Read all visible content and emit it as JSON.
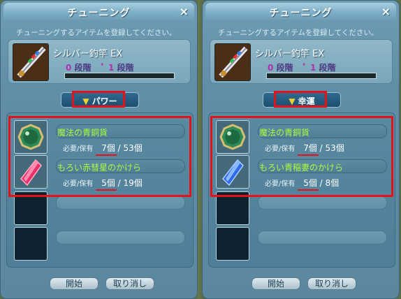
{
  "panels": [
    {
      "title": "チューニング",
      "close": "×",
      "instruction": "チューニングするアイテムを登録してください。",
      "item": {
        "name": "シルバー釣竿 EX",
        "level1_num": "0",
        "level1_text": "段階",
        "level2_icon": "ﾟ",
        "level2_num": "1",
        "level2_text": "段階"
      },
      "selector": {
        "label": "パワー"
      },
      "materials": [
        {
          "name": "魔法の青銅貨",
          "req_label": "必要/保有",
          "need": "7個",
          "sep": "/",
          "have": "53個",
          "icon": "bronze-coin-icon"
        },
        {
          "name": "もろい赤彗星のかけら",
          "req_label": "必要/保有",
          "need": "5個",
          "sep": "/",
          "have": "19個",
          "icon": "red-crystal-icon"
        }
      ],
      "buttons": {
        "start": "開始",
        "cancel": "取り消し"
      }
    },
    {
      "title": "チューニング",
      "close": "×",
      "instruction": "チューニングするアイテムを登録してください。",
      "item": {
        "name": "シルバー釣竿 EX",
        "level1_num": "0",
        "level1_text": "段階",
        "level2_icon": "ﾟ",
        "level2_num": "1",
        "level2_text": "段階"
      },
      "selector": {
        "label": "幸運"
      },
      "materials": [
        {
          "name": "魔法の青銅貨",
          "req_label": "必要/保有",
          "need": "7個",
          "sep": "/",
          "have": "53個",
          "icon": "bronze-coin-icon"
        },
        {
          "name": "もろい青稲妻のかけら",
          "req_label": "必要/保有",
          "need": "5個",
          "sep": "/",
          "have": "8個",
          "icon": "blue-crystal-icon"
        }
      ],
      "buttons": {
        "start": "開始",
        "cancel": "取り消し"
      }
    }
  ],
  "colors": {
    "highlight": "#e4131a",
    "material_name": "#a8ff3c",
    "panel": "#5f8ea6"
  }
}
